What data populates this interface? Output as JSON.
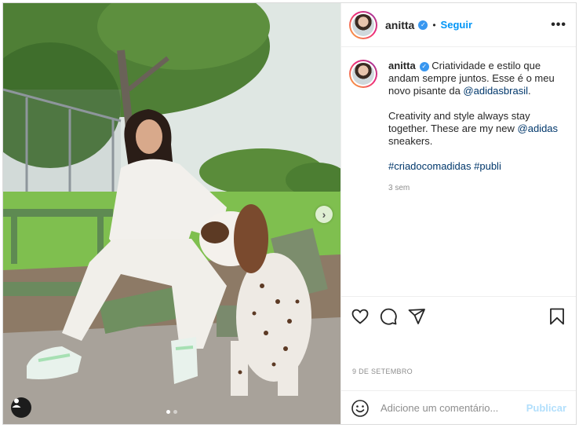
{
  "post": {
    "username": "anitta",
    "follow_label": "Seguir",
    "separator": "•",
    "more_label": "•••",
    "caption": {
      "username": "anitta",
      "line1_text": "Criatividade e estilo que andam sempre juntos. Esse é o meu novo pisante da ",
      "line1_mention": "@adidasbrasil",
      "line1_end": ".",
      "line2_text": "Creativity and style always stay together. These are my new ",
      "line2_mention": "@adidas",
      "line2_end": " sneakers.",
      "hashtag1": "#criadocomadidas",
      "hashtag2": "#publi",
      "age": "3 sem"
    },
    "date": "9 DE SETEMBRO",
    "comment": {
      "placeholder": "Adicione um comentário...",
      "publish_label": "Publicar"
    },
    "media": {
      "carousel_count": 2,
      "carousel_active": 0,
      "next_label": "›"
    }
  },
  "icons": [
    "verified-icon",
    "more-icon",
    "heart-icon",
    "comment-icon",
    "share-icon",
    "bookmark-icon",
    "emoji-icon",
    "user-tag-icon",
    "chevron-right-icon"
  ],
  "colors": {
    "accent": "#0095f6",
    "verified": "#3897f0",
    "mention": "#00376b",
    "muted": "#8e8e8e",
    "publish_disabled": "#b2dffc"
  }
}
